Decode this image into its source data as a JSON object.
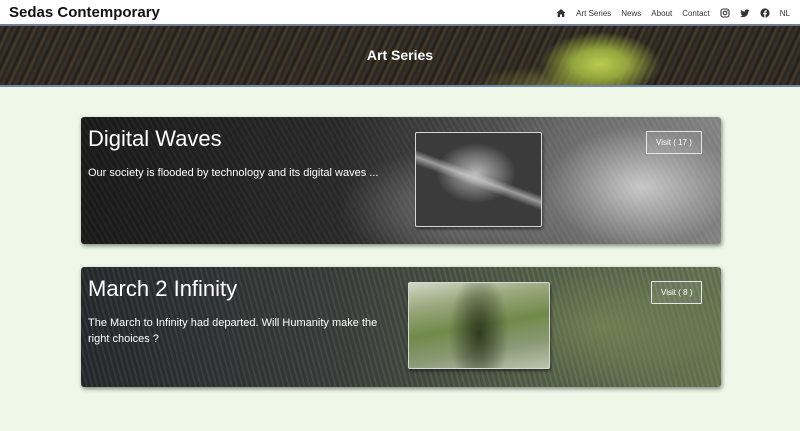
{
  "header": {
    "brand": "Sedas Contemporary",
    "nav": [
      {
        "label": "Art Series"
      },
      {
        "label": "News"
      },
      {
        "label": "About"
      },
      {
        "label": "Contact"
      }
    ],
    "icons": [
      "home-icon",
      "instagram-icon",
      "twitter-icon",
      "facebook-icon"
    ],
    "language": "NL"
  },
  "hero": {
    "title": "Art Series"
  },
  "series": [
    {
      "title": "Digital Waves",
      "description": "Our society is flooded by technology and its digital waves ...",
      "visit_label": "Visit ( 17 )"
    },
    {
      "title": "March 2 Infinity",
      "description": "The March to Infinity had departed. Will Humanity make the right choices ?",
      "visit_label": "Visit ( 8 )"
    }
  ],
  "colors": {
    "page_background": "#eef7e8",
    "nav_border": "#6f7f97",
    "hero_border": "#7085a8"
  }
}
